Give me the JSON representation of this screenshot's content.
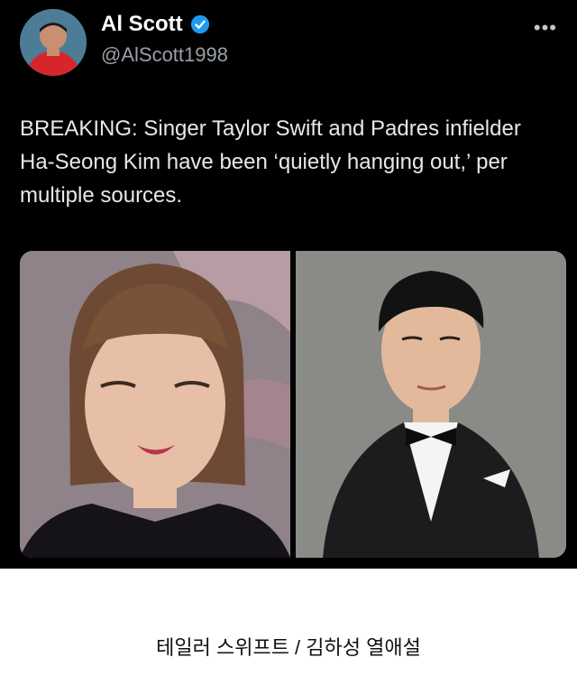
{
  "tweet": {
    "author_name": "Al Scott",
    "handle": "@AlScott1998",
    "more_label": "•••",
    "text": "BREAKING: Singer Taylor Swift and Padres infielder Ha-Seong Kim have been ‘quietly hanging out,’ per multiple sources."
  },
  "images": {
    "left_icon": "woman-portrait",
    "right_icon": "man-tuxedo-portrait"
  },
  "colors": {
    "background": "#000000",
    "text": "#e8e8e8",
    "handle": "#9aa0a6",
    "verified": "#1d9bf0"
  },
  "caption": "테일러 스위프트 / 김하성 열애설"
}
